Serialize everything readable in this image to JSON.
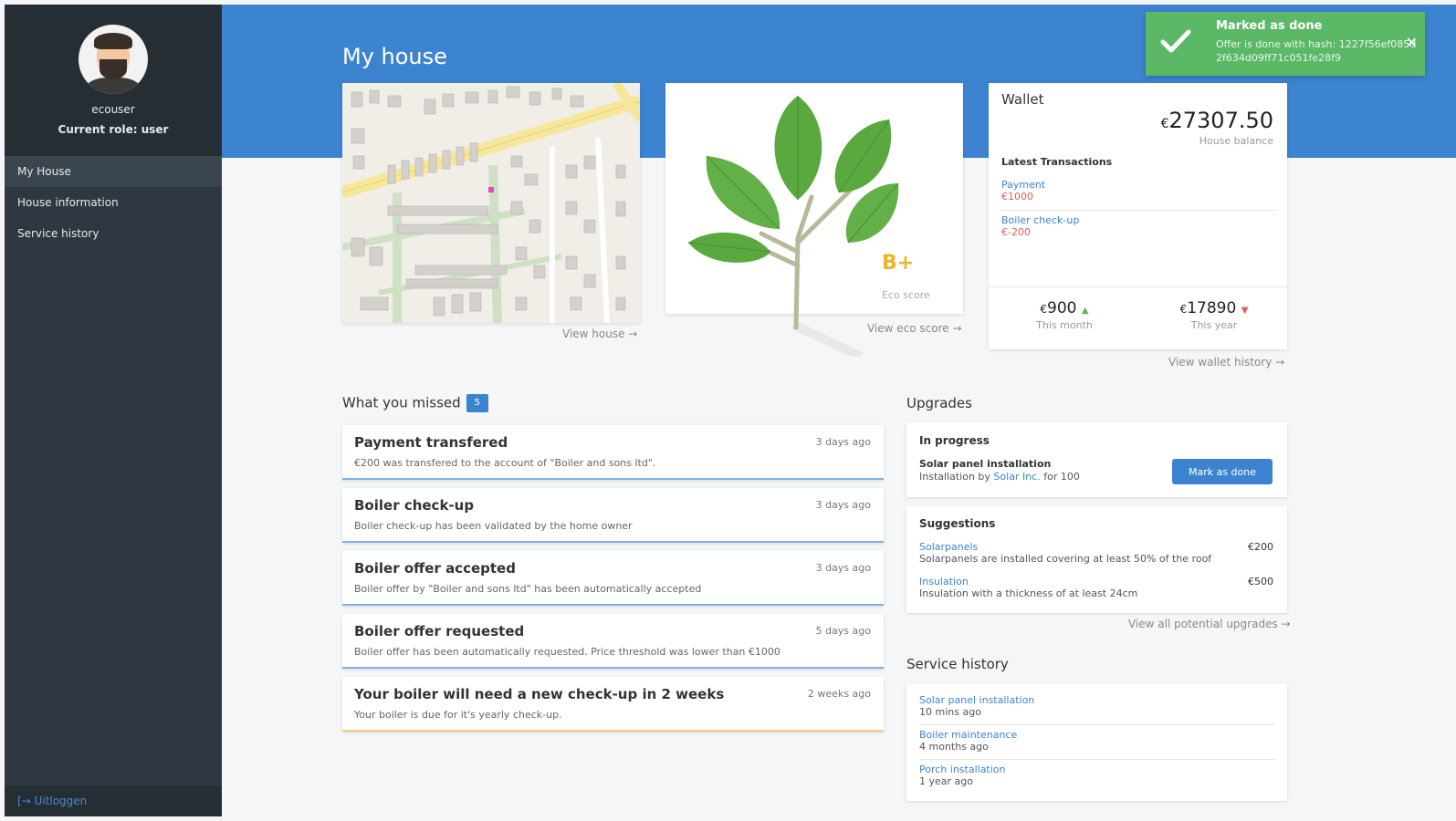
{
  "sidebar": {
    "username": "ecouser",
    "role": "Current role: user",
    "nav": [
      {
        "label": "My House"
      },
      {
        "label": "House information"
      },
      {
        "label": "Service history"
      }
    ],
    "logout": "[→ Uitloggen"
  },
  "page": {
    "title": "My house"
  },
  "map": {
    "link": "View house →"
  },
  "eco": {
    "grade": "B+",
    "label": "Eco score",
    "link": "View eco score →"
  },
  "wallet": {
    "title": "Wallet",
    "currency": "€",
    "balance": "27307.50",
    "balance_label": "House balance",
    "latest_label": "Latest Transactions",
    "transactions": [
      {
        "name": "Payment",
        "amount": "€1000"
      },
      {
        "name": "Boiler check-up",
        "amount": "€-200"
      }
    ],
    "month_value": "900",
    "month_label": "This month",
    "year_value": "17890",
    "year_label": "This year",
    "link": "View wallet history →"
  },
  "missed": {
    "title": "What you missed",
    "count": "5",
    "items": [
      {
        "title": "Payment transfered",
        "time": "3 days ago",
        "desc": "€200 was transfered to the account of \"Boiler and sons ltd\"."
      },
      {
        "title": "Boiler check-up",
        "time": "3 days ago",
        "desc": "Boiler check-up has been validated by the home owner"
      },
      {
        "title": "Boiler offer accepted",
        "time": "3 days ago",
        "desc": "Boiler offer by \"Boiler and sons ltd\" has been automatically accepted"
      },
      {
        "title": "Boiler offer requested",
        "time": "5 days ago",
        "desc": "Boiler offer has been automatically requested. Price threshold was lower than €1000"
      },
      {
        "title": "Your boiler will need a new check-up in 2 weeks",
        "time": "2 weeks ago",
        "desc": "Your boiler is due for it's yearly check-up."
      }
    ]
  },
  "upgrades": {
    "title": "Upgrades",
    "in_progress_label": "In progress",
    "in_progress_name": "Solar panel installation",
    "in_progress_by_prefix": "Installation by ",
    "in_progress_company": "Solar Inc.",
    "in_progress_suffix": " for 100",
    "mark_done": "Mark as done",
    "suggestions_label": "Suggestions",
    "suggestions": [
      {
        "name": "Solarpanels",
        "desc": "Solarpanels are installed covering at least 50% of the roof",
        "price": "€200"
      },
      {
        "name": "Insulation",
        "desc": "Insulation with a thickness of at least 24cm",
        "price": "€500"
      }
    ],
    "link": "View all potential upgrades →"
  },
  "service": {
    "title": "Service history",
    "items": [
      {
        "name": "Solar panel installation",
        "time": "10 mins ago"
      },
      {
        "name": "Boiler maintenance",
        "time": "4 months ago"
      },
      {
        "name": "Porch installation",
        "time": "1 year ago"
      }
    ]
  },
  "toast": {
    "title": "Marked as done",
    "message": "Offer is done with hash: 1227f56ef085d2f634d09ff71c051fe28f9",
    "close": "✕"
  },
  "colors": {
    "primary": "#3c84d0",
    "sidebar": "#2f3840",
    "success": "#5ab867",
    "negative": "#e05a5a",
    "eco": "#f0b429"
  }
}
